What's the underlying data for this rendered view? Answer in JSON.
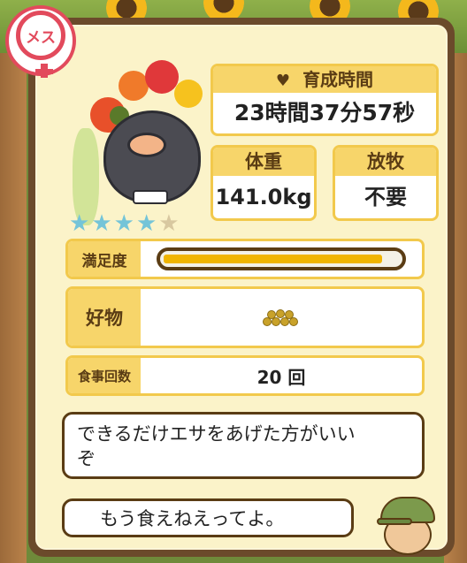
{
  "profile": {
    "gender_label": "メス",
    "stars": {
      "filled": 4,
      "total": 5
    }
  },
  "growth_time": {
    "label": "育成時間",
    "value": "23時間37分57秒"
  },
  "weight": {
    "label": "体重",
    "value": "141.0kg"
  },
  "grazing": {
    "label": "放牧",
    "value": "不要"
  },
  "satisfaction": {
    "label": "満足度",
    "level": 0.93
  },
  "favorite_food": {
    "label": "好物",
    "icon": "feed-pellets-icon"
  },
  "meal_count": {
    "label": "食事回数",
    "value": "20 回"
  },
  "dialogue": {
    "line1": "できるだけエサをあげた方がいい\nぞ",
    "line2": "もう食えねえってよ。"
  },
  "colors": {
    "header_yellow": "#f7d56a",
    "frame_brown": "#6b4a2b",
    "female_pink": "#e24a5c",
    "bar_fill": "#f0b400",
    "star_on": "#74c4d8"
  }
}
